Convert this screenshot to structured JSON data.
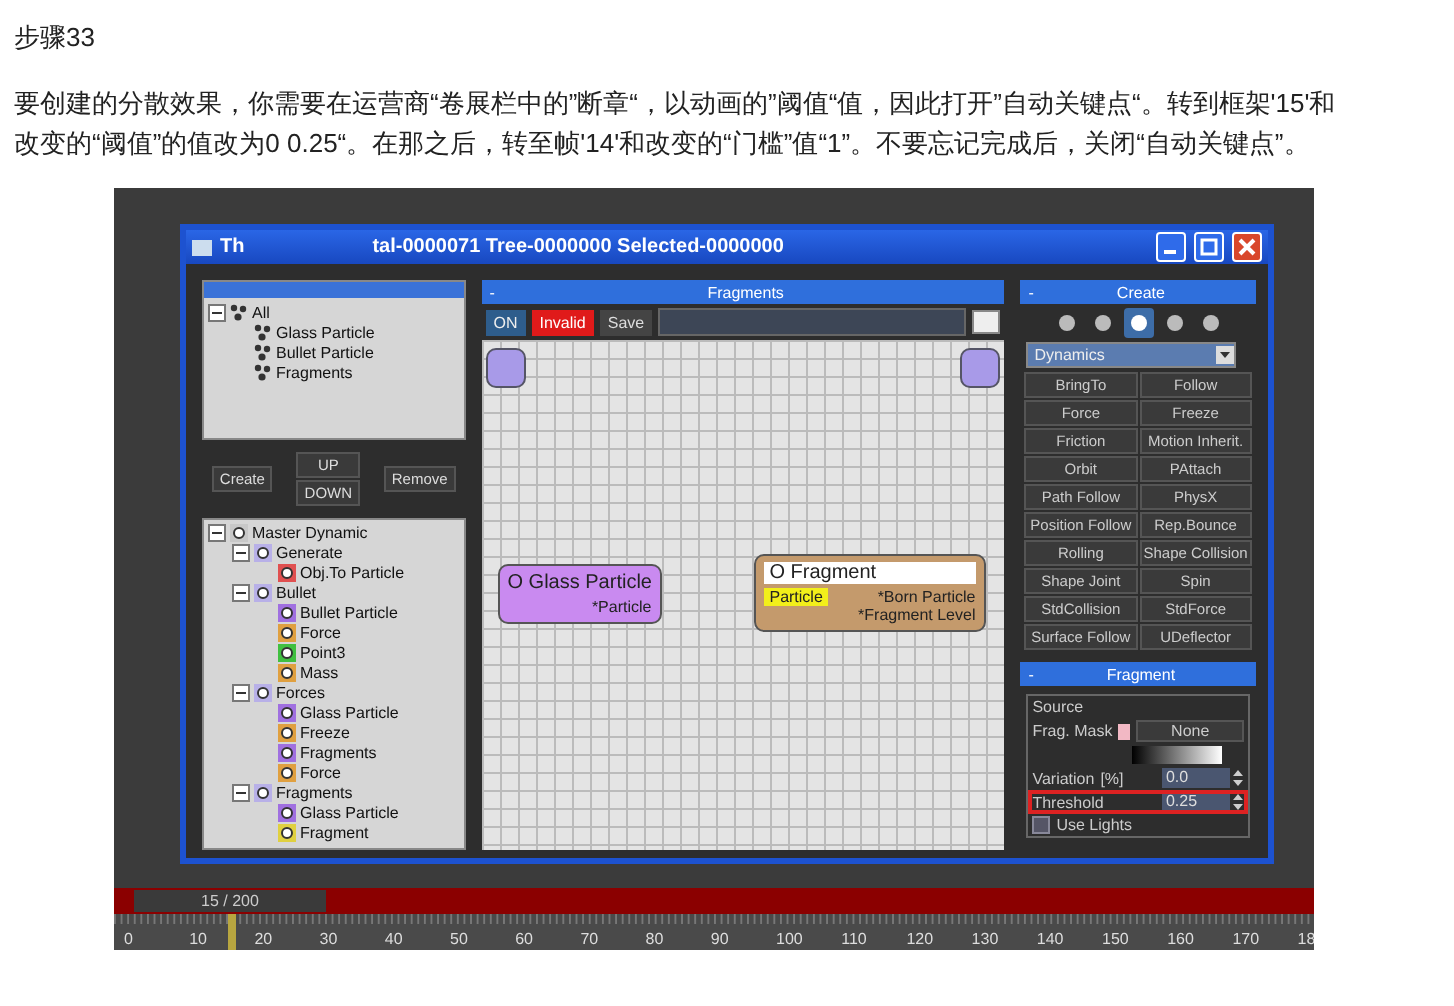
{
  "heading": "步骤33",
  "paragraph": "要创建的分散效果，你需要在运营商“卷展栏中的”断章“，以动画的”阈值“值，因此打开”自动关键点“。转到框架'15'和改变的“阈值”的值改为0 0.25“。在那之后，转至帧'14'和改变的“门槛”值“1”。不要忘记完成后，关闭“自动关键点”。",
  "window": {
    "title": "Th",
    "title_rest": "tal-0000071  Tree-0000000  Selected-0000000",
    "events_tree": [
      {
        "label": "All",
        "expanded": true,
        "children": [
          {
            "label": "Glass Particle"
          },
          {
            "label": "Bullet Particle"
          },
          {
            "label": "Fragments"
          }
        ]
      }
    ],
    "tree_buttons": {
      "create": "Create",
      "up": "UP",
      "down": "DOWN",
      "remove": "Remove"
    },
    "master_tree": [
      {
        "label": "Master Dynamic",
        "color": "#c8c8c8",
        "expanded": true,
        "children": [
          {
            "label": "Generate",
            "color": "#b8b0e8",
            "expanded": true,
            "children": [
              {
                "label": "Obj.To Particle",
                "color": "#e05050"
              }
            ]
          },
          {
            "label": "Bullet",
            "color": "#b8b0e8",
            "expanded": true,
            "children": [
              {
                "label": "Bullet Particle",
                "color": "#a070e0"
              },
              {
                "label": "Force",
                "color": "#e0a040"
              },
              {
                "label": "Point3",
                "color": "#40c040"
              },
              {
                "label": "Mass",
                "color": "#e0a040"
              }
            ]
          },
          {
            "label": "Forces",
            "color": "#b8b0e8",
            "expanded": true,
            "children": [
              {
                "label": "Glass Particle",
                "color": "#a070e0"
              },
              {
                "label": "Freeze",
                "color": "#e0a040"
              },
              {
                "label": "Fragments",
                "color": "#a070e0"
              },
              {
                "label": "Force",
                "color": "#e0a040"
              }
            ]
          },
          {
            "label": "Fragments",
            "color": "#b8b0e8",
            "expanded": true,
            "children": [
              {
                "label": "Glass Particle",
                "color": "#a070e0"
              },
              {
                "label": "Fragment",
                "color": "#e0d040"
              }
            ]
          }
        ]
      }
    ],
    "graph": {
      "title": "Fragments",
      "collapse": "-",
      "on": "ON",
      "status": "Invalid",
      "save": "Save",
      "nodes": [
        {
          "title": "O Glass Particle",
          "color": "#c98af0",
          "outputs": [
            "*Particle"
          ]
        },
        {
          "title": "O Fragment",
          "color": "#c49a6c",
          "tag": "Particle",
          "outputs": [
            "*Born Particle",
            "*Fragment Level"
          ]
        }
      ]
    },
    "create": {
      "title": "Create",
      "collapse": "-",
      "tool_icons": [
        {
          "selected": false
        },
        {
          "selected": false
        },
        {
          "selected": true
        },
        {
          "selected": false
        },
        {
          "selected": false
        }
      ],
      "category": "Dynamics",
      "buttons": [
        "BringTo",
        "Follow",
        "Force",
        "Freeze",
        "Friction",
        "Motion Inherit.",
        "Orbit",
        "PAttach",
        "Path Follow",
        "PhysX",
        "Position Follow",
        "Rep.Bounce",
        "Rolling",
        "Shape Collision",
        "Shape Joint",
        "Spin",
        "StdCollision",
        "StdForce",
        "Surface Follow",
        "UDeflector"
      ]
    },
    "fragment": {
      "title": "Fragment",
      "collapse": "-",
      "group": "Source",
      "frag_mask": "Frag. Mask",
      "mask_button": "None",
      "variation": {
        "label": "Variation",
        "unit": "[%]",
        "value": "0.0"
      },
      "threshold": {
        "label": "Threshold",
        "value": "0.25",
        "highlighted": true
      },
      "use_lights": {
        "label": "Use Lights",
        "checked": false
      }
    }
  },
  "timeline": {
    "frame_counter": "15 / 200",
    "level": 0.083,
    "ticks": [
      "0",
      "10",
      "20",
      "30",
      "40",
      "50",
      "60",
      "70",
      "80",
      "90",
      "100",
      "110",
      "120",
      "130",
      "140",
      "150",
      "160",
      "170",
      "18"
    ]
  }
}
